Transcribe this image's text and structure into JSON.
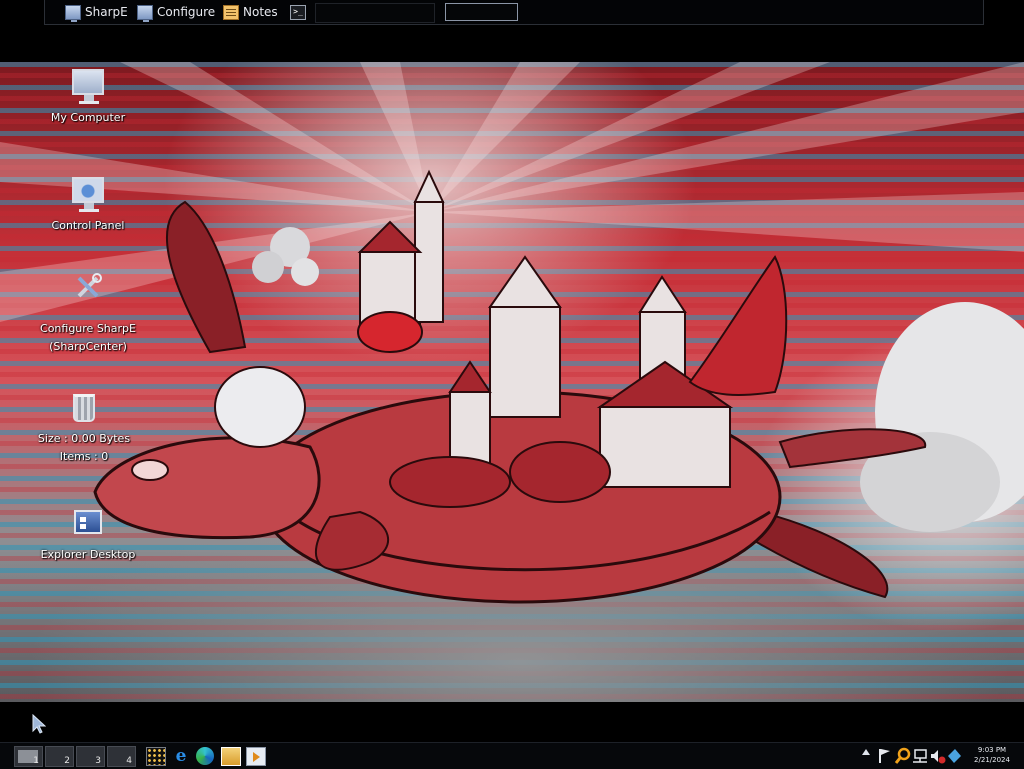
{
  "topbar": {
    "items": [
      {
        "label": "SharpE",
        "icon": "monitor-icon"
      },
      {
        "label": "Configure",
        "icon": "monitor-icon"
      },
      {
        "label": "Notes",
        "icon": "notes-icon"
      },
      {
        "label": "",
        "icon": "terminal-icon"
      }
    ]
  },
  "desktop": {
    "icons": [
      {
        "label": "My Computer",
        "icon": "computer-icon"
      },
      {
        "label": "Control Panel",
        "icon": "control-panel-icon"
      },
      {
        "label_line1": "Configure SharpE",
        "label_line2": "(SharpCenter)",
        "icon": "tools-icon"
      },
      {
        "label_line1": "Size : 0.00 Bytes",
        "label_line2": "Items : 0",
        "icon": "recycle-bin-icon"
      },
      {
        "label": "Explorer Desktop",
        "icon": "explorer-desktop-icon"
      }
    ]
  },
  "taskbar": {
    "virtual_desktops": [
      "1",
      "2",
      "3",
      "4"
    ],
    "active_desktop": "1",
    "launchers": [
      "app-grid-icon",
      "internet-explorer-icon",
      "edge-icon",
      "file-explorer-icon",
      "media-player-icon"
    ],
    "tray_icons": [
      "show-hidden-icons",
      "flag-icon",
      "search-icon",
      "network-icon",
      "volume-muted-icon",
      "app-icon"
    ],
    "clock": {
      "time": "9:03 PM",
      "date": "2/21/2024"
    }
  },
  "colors": {
    "wallpaper_red": "#c43038",
    "wallpaper_teal": "#2d96b9",
    "taskbar_bg": "#06080b"
  }
}
